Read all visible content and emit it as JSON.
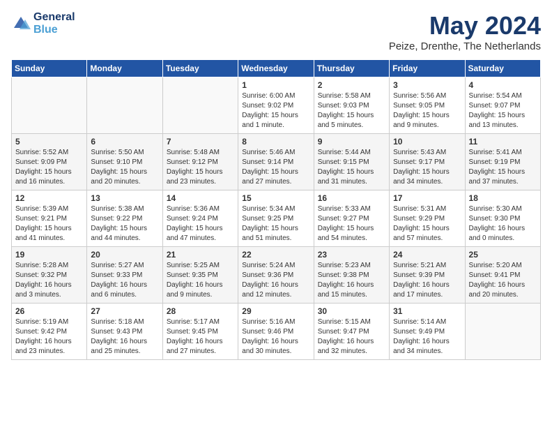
{
  "logo": {
    "line1": "General",
    "line2": "Blue"
  },
  "title": "May 2024",
  "subtitle": "Peize, Drenthe, The Netherlands",
  "headers": [
    "Sunday",
    "Monday",
    "Tuesday",
    "Wednesday",
    "Thursday",
    "Friday",
    "Saturday"
  ],
  "weeks": [
    [
      {
        "day": "",
        "info": ""
      },
      {
        "day": "",
        "info": ""
      },
      {
        "day": "",
        "info": ""
      },
      {
        "day": "1",
        "info": "Sunrise: 6:00 AM\nSunset: 9:02 PM\nDaylight: 15 hours\nand 1 minute."
      },
      {
        "day": "2",
        "info": "Sunrise: 5:58 AM\nSunset: 9:03 PM\nDaylight: 15 hours\nand 5 minutes."
      },
      {
        "day": "3",
        "info": "Sunrise: 5:56 AM\nSunset: 9:05 PM\nDaylight: 15 hours\nand 9 minutes."
      },
      {
        "day": "4",
        "info": "Sunrise: 5:54 AM\nSunset: 9:07 PM\nDaylight: 15 hours\nand 13 minutes."
      }
    ],
    [
      {
        "day": "5",
        "info": "Sunrise: 5:52 AM\nSunset: 9:09 PM\nDaylight: 15 hours\nand 16 minutes."
      },
      {
        "day": "6",
        "info": "Sunrise: 5:50 AM\nSunset: 9:10 PM\nDaylight: 15 hours\nand 20 minutes."
      },
      {
        "day": "7",
        "info": "Sunrise: 5:48 AM\nSunset: 9:12 PM\nDaylight: 15 hours\nand 23 minutes."
      },
      {
        "day": "8",
        "info": "Sunrise: 5:46 AM\nSunset: 9:14 PM\nDaylight: 15 hours\nand 27 minutes."
      },
      {
        "day": "9",
        "info": "Sunrise: 5:44 AM\nSunset: 9:15 PM\nDaylight: 15 hours\nand 31 minutes."
      },
      {
        "day": "10",
        "info": "Sunrise: 5:43 AM\nSunset: 9:17 PM\nDaylight: 15 hours\nand 34 minutes."
      },
      {
        "day": "11",
        "info": "Sunrise: 5:41 AM\nSunset: 9:19 PM\nDaylight: 15 hours\nand 37 minutes."
      }
    ],
    [
      {
        "day": "12",
        "info": "Sunrise: 5:39 AM\nSunset: 9:21 PM\nDaylight: 15 hours\nand 41 minutes."
      },
      {
        "day": "13",
        "info": "Sunrise: 5:38 AM\nSunset: 9:22 PM\nDaylight: 15 hours\nand 44 minutes."
      },
      {
        "day": "14",
        "info": "Sunrise: 5:36 AM\nSunset: 9:24 PM\nDaylight: 15 hours\nand 47 minutes."
      },
      {
        "day": "15",
        "info": "Sunrise: 5:34 AM\nSunset: 9:25 PM\nDaylight: 15 hours\nand 51 minutes."
      },
      {
        "day": "16",
        "info": "Sunrise: 5:33 AM\nSunset: 9:27 PM\nDaylight: 15 hours\nand 54 minutes."
      },
      {
        "day": "17",
        "info": "Sunrise: 5:31 AM\nSunset: 9:29 PM\nDaylight: 15 hours\nand 57 minutes."
      },
      {
        "day": "18",
        "info": "Sunrise: 5:30 AM\nSunset: 9:30 PM\nDaylight: 16 hours\nand 0 minutes."
      }
    ],
    [
      {
        "day": "19",
        "info": "Sunrise: 5:28 AM\nSunset: 9:32 PM\nDaylight: 16 hours\nand 3 minutes."
      },
      {
        "day": "20",
        "info": "Sunrise: 5:27 AM\nSunset: 9:33 PM\nDaylight: 16 hours\nand 6 minutes."
      },
      {
        "day": "21",
        "info": "Sunrise: 5:25 AM\nSunset: 9:35 PM\nDaylight: 16 hours\nand 9 minutes."
      },
      {
        "day": "22",
        "info": "Sunrise: 5:24 AM\nSunset: 9:36 PM\nDaylight: 16 hours\nand 12 minutes."
      },
      {
        "day": "23",
        "info": "Sunrise: 5:23 AM\nSunset: 9:38 PM\nDaylight: 16 hours\nand 15 minutes."
      },
      {
        "day": "24",
        "info": "Sunrise: 5:21 AM\nSunset: 9:39 PM\nDaylight: 16 hours\nand 17 minutes."
      },
      {
        "day": "25",
        "info": "Sunrise: 5:20 AM\nSunset: 9:41 PM\nDaylight: 16 hours\nand 20 minutes."
      }
    ],
    [
      {
        "day": "26",
        "info": "Sunrise: 5:19 AM\nSunset: 9:42 PM\nDaylight: 16 hours\nand 23 minutes."
      },
      {
        "day": "27",
        "info": "Sunrise: 5:18 AM\nSunset: 9:43 PM\nDaylight: 16 hours\nand 25 minutes."
      },
      {
        "day": "28",
        "info": "Sunrise: 5:17 AM\nSunset: 9:45 PM\nDaylight: 16 hours\nand 27 minutes."
      },
      {
        "day": "29",
        "info": "Sunrise: 5:16 AM\nSunset: 9:46 PM\nDaylight: 16 hours\nand 30 minutes."
      },
      {
        "day": "30",
        "info": "Sunrise: 5:15 AM\nSunset: 9:47 PM\nDaylight: 16 hours\nand 32 minutes."
      },
      {
        "day": "31",
        "info": "Sunrise: 5:14 AM\nSunset: 9:49 PM\nDaylight: 16 hours\nand 34 minutes."
      },
      {
        "day": "",
        "info": ""
      }
    ]
  ]
}
